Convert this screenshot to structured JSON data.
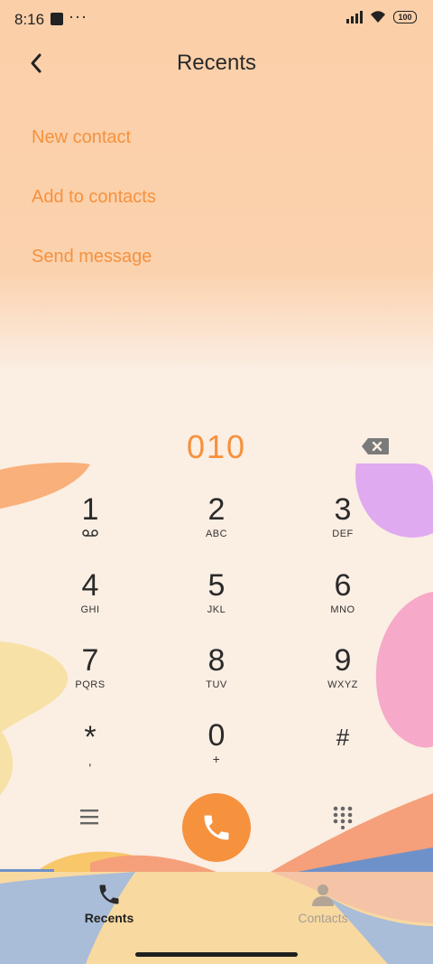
{
  "status": {
    "time": "8:16",
    "dots": "···",
    "battery": "100"
  },
  "header": {
    "title": "Recents"
  },
  "menu": {
    "items": [
      "New contact",
      "Add to contacts",
      "Send message"
    ]
  },
  "dialer": {
    "number": "010",
    "keys": [
      {
        "digit": "1",
        "letters": ""
      },
      {
        "digit": "2",
        "letters": "ABC"
      },
      {
        "digit": "3",
        "letters": "DEF"
      },
      {
        "digit": "4",
        "letters": "GHI"
      },
      {
        "digit": "5",
        "letters": "JKL"
      },
      {
        "digit": "6",
        "letters": "MNO"
      },
      {
        "digit": "7",
        "letters": "PQRS"
      },
      {
        "digit": "8",
        "letters": "TUV"
      },
      {
        "digit": "9",
        "letters": "WXYZ"
      },
      {
        "digit": "*",
        "letters": ","
      },
      {
        "digit": "0",
        "letters": "+"
      },
      {
        "digit": "#",
        "letters": ""
      }
    ]
  },
  "tabs": {
    "recents": "Recents",
    "contacts": "Contacts"
  },
  "colors": {
    "accent": "#f6913d",
    "background": "#fbeee3",
    "header_bg": "#fbcfa8"
  }
}
